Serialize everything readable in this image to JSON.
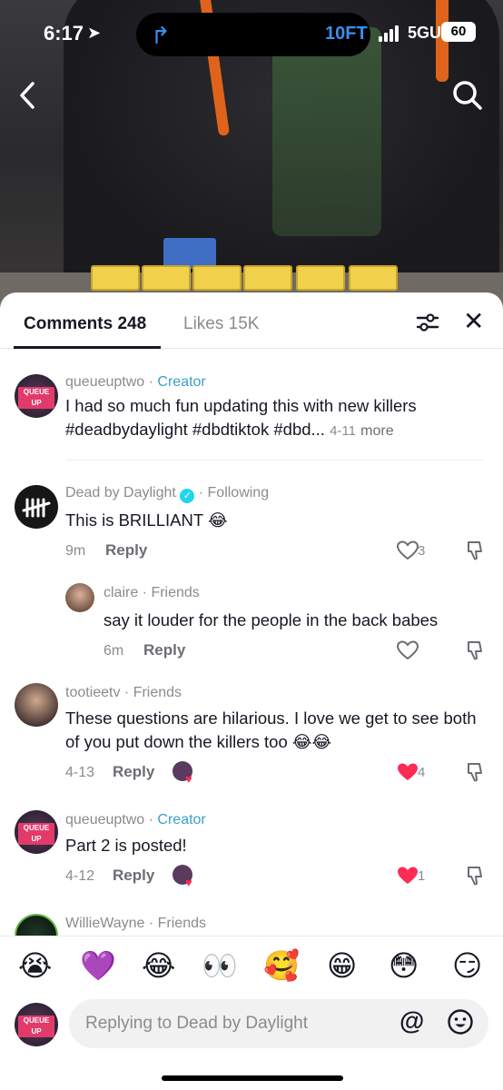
{
  "status_bar": {
    "time": "6:17",
    "distance": "10FT",
    "network": "5GUW",
    "battery": "60"
  },
  "header": {
    "back": "back",
    "search": "search"
  },
  "tabs": {
    "comments": "Comments 248",
    "likes": "Likes 15K"
  },
  "comments": [
    {
      "username": "queueuptwo",
      "badge": "Creator",
      "text": "I had so much fun updating this with new killers #deadbydaylight #dbdtiktok #dbd...",
      "date": "4-11",
      "more": "more"
    },
    {
      "username": "Dead by Daylight",
      "badge": "Following",
      "text": "This is BRILLIANT 😂",
      "time": "9m",
      "reply": "Reply",
      "likes": "3"
    },
    {
      "username": "claire",
      "badge": "Friends",
      "text": "say it louder for the people in the back babes",
      "time": "6m",
      "reply": "Reply"
    },
    {
      "username": "tootieetv",
      "badge": "Friends",
      "text": "These questions are hilarious. I love we get to see both of you put down the killers too 😂😂",
      "date": "4-13",
      "reply": "Reply",
      "likes": "4"
    },
    {
      "username": "queueuptwo",
      "badge": "Creator",
      "text": "Part 2 is posted!",
      "date": "4-12",
      "reply": "Reply",
      "likes": "1"
    },
    {
      "username": "WillieWayne",
      "badge": "Friends"
    }
  ],
  "emoji_bar": [
    "😭",
    "💜",
    "😂",
    "👀",
    "🥰",
    "😁",
    "😳",
    "😏"
  ],
  "input": {
    "placeholder": "Replying to Dead by Daylight",
    "at": "@"
  },
  "colors": {
    "creator": "#3aa0c8",
    "like_red": "#fe2c55",
    "verified": "#20d5ec"
  }
}
